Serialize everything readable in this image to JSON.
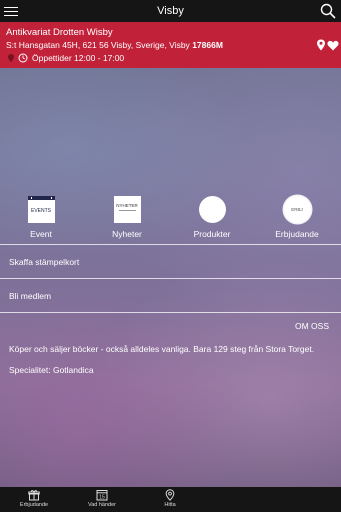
{
  "header": {
    "title": "Visby"
  },
  "store": {
    "name": "Antikvariat Drotten Wisby",
    "address": "S:t Hansgatan 45H, 621 56 Visby, Sverige, Visby",
    "distance": "17866M",
    "hours": "Öppettider 12:00 - 17:00"
  },
  "categories": [
    {
      "label": "Event",
      "icon_text": "EVENTS"
    },
    {
      "label": "Nyheter",
      "icon_text": "NYHETER"
    },
    {
      "label": "Produkter",
      "icon_text": ""
    },
    {
      "label": "Erbjudande",
      "icon_text": "ERBJ"
    }
  ],
  "actions": {
    "stamp_card": "Skaffa stämpelkort",
    "become_member": "Bli medlem"
  },
  "about": {
    "heading": "OM OSS",
    "text": "Köper och säljer böcker - också alldeles vanliga. Bara 129 steg från Stora Torget.",
    "speciality": "Specialitet: Gotlandica"
  },
  "tabs": [
    {
      "label": "Erbjudande"
    },
    {
      "label": "Vad händer",
      "icon_text": "15"
    },
    {
      "label": "Hitta"
    }
  ],
  "colors": {
    "store_bar": "#c1223a",
    "top_bar": "#151515",
    "tab_bar": "#151515"
  }
}
